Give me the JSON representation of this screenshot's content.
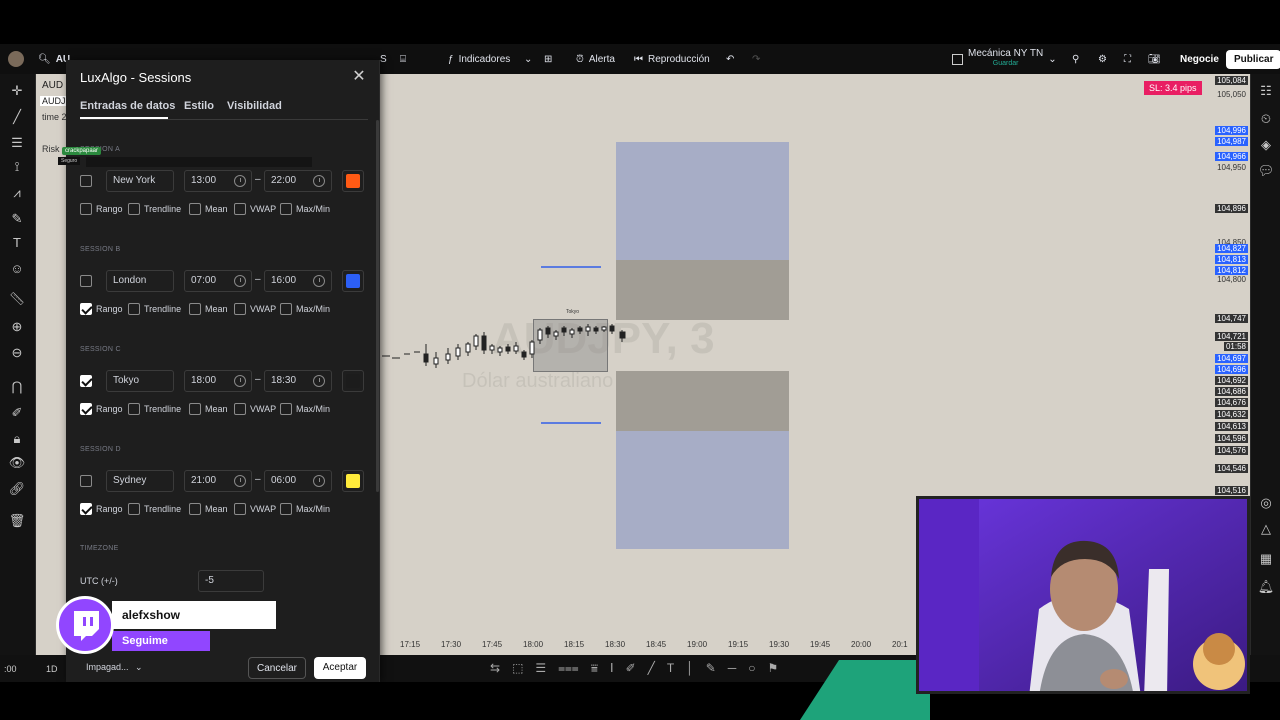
{
  "toolbar": {
    "symbol": "AU",
    "interval": "S",
    "indicators": "Indicadores",
    "alert": "Alerta",
    "replay": "Reproducción",
    "layout_name": "Mecánica NY TN",
    "layout_saved": "Guardar",
    "trade": "Negocie",
    "publish": "Publicar"
  },
  "chart": {
    "symbol_partial": "AUD",
    "sl_badge": "SL: 3.4 pips",
    "time_label": "time 2",
    "risk_label": "Risk",
    "watermark": "AUDJPY, 3",
    "watermark_sub": "Dólar australiano / Yen japonés",
    "session_tag": "Tokyo",
    "price_labels": [
      "105,084",
      "105,050",
      "104,996",
      "104,987",
      "104,966",
      "104,950",
      "104,896",
      "104,850",
      "104,827",
      "104,813",
      "104,812",
      "104,800",
      "104,747",
      "104,721",
      "01:58",
      "104,697",
      "104,696",
      "104,692",
      "104,686",
      "104,676",
      "104,632",
      "104,613",
      "104,596",
      "104,576",
      "104,546",
      "104,516"
    ],
    "time_labels": [
      "17:15",
      "17:30",
      "17:45",
      "18:00",
      "18:15",
      "18:30",
      "18:45",
      "19:00",
      "19:15",
      "19:30",
      "19:45",
      "20:00",
      "20:1"
    ],
    "bottom_left_labels": [
      "1D",
      ":00"
    ],
    "colors": {
      "background": "#d6d1c8",
      "box_blue": "#a7adc6",
      "box_gray": "#a19d95",
      "highlight": "#2962ff",
      "sl_badge": "#e91e63"
    }
  },
  "dialog": {
    "title": "LuxAlgo - Sessions",
    "tabs": [
      "Entradas de datos",
      "Estilo",
      "Visibilidad"
    ],
    "options": [
      "Rango",
      "Trendline",
      "Mean",
      "VWAP",
      "Max/Min"
    ],
    "sessions": [
      {
        "header": "SESSION A",
        "enabled": false,
        "name": "New York",
        "start": "13:00",
        "end": "22:00",
        "color": "#ff5a14",
        "checks": [
          false,
          false,
          false,
          false,
          false
        ]
      },
      {
        "header": "SESSION B",
        "enabled": false,
        "name": "London",
        "start": "07:00",
        "end": "16:00",
        "color": "#2c5ff6",
        "checks": [
          true,
          false,
          false,
          false,
          false
        ]
      },
      {
        "header": "SESSION C",
        "enabled": true,
        "name": "Tokyo",
        "start": "18:00",
        "end": "18:30",
        "color": "#1c1c1c",
        "checks": [
          true,
          false,
          false,
          false,
          false
        ]
      },
      {
        "header": "SESSION D",
        "enabled": false,
        "name": "Sydney",
        "start": "21:00",
        "end": "06:00",
        "color": "#ffeb3b",
        "checks": [
          true,
          false,
          false,
          false,
          false
        ]
      }
    ],
    "timezone_header": "TIMEZONE",
    "utc_label": "UTC (+/-)",
    "utc_value": "-5",
    "defaults_select": "Impagad...",
    "cancel": "Cancelar",
    "accept": "Aceptar"
  },
  "overlay": {
    "crack_tag": "crackpapaar",
    "seguro_tag": "Seguro",
    "twitch_name": "alefxshow",
    "twitch_follow": "Seguime"
  }
}
